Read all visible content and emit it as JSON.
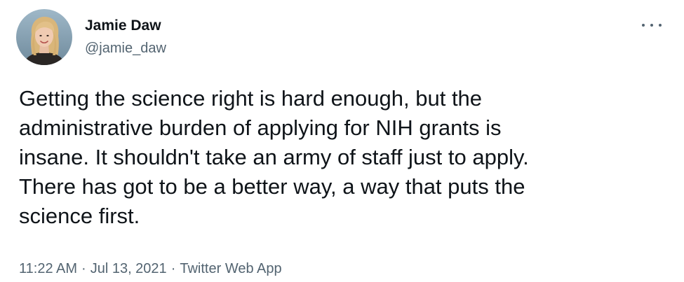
{
  "tweet": {
    "author": {
      "display_name": "Jamie Daw",
      "handle": "@jamie_daw",
      "avatar_icon": "profile-photo"
    },
    "more_icon": "more-horizontal-icon",
    "text_lines": [
      "Getting the science right is hard enough, but the",
      "administrative burden of applying for NIH grants is",
      "insane. It shouldn't take an army of staff just to apply.",
      "There has got to be a better way, a way that puts the",
      "science first."
    ],
    "meta": {
      "time": "11:22 AM",
      "separator": "·",
      "date": "Jul 13, 2021",
      "source": "Twitter Web App"
    },
    "colors": {
      "text": "#0f1419",
      "secondary": "#536471",
      "background": "#ffffff"
    }
  }
}
